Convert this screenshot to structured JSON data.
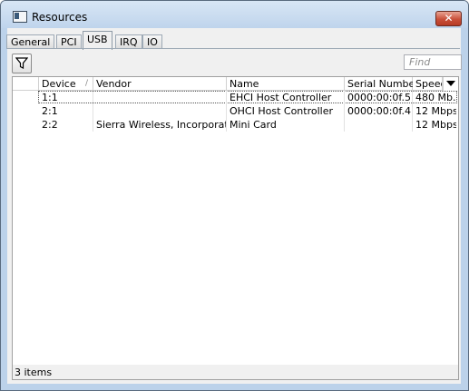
{
  "window": {
    "title": "Resources",
    "close_glyph": "✕"
  },
  "tabs": [
    {
      "label": "General"
    },
    {
      "label": "PCI"
    },
    {
      "label": "USB"
    },
    {
      "label": "IRQ"
    },
    {
      "label": "IO"
    }
  ],
  "toolbar": {
    "filter_icon": "filter-icon",
    "find_placeholder": "Find"
  },
  "table": {
    "columns": [
      "Device",
      "Vendor",
      "Name",
      "Serial Number",
      "Speed"
    ],
    "sort_indicator": "/",
    "rows": [
      {
        "device": "1:1",
        "vendor": "",
        "name": "EHCI Host Controller",
        "serial": "0000:00:0f.5",
        "speed": "480 Mb..."
      },
      {
        "device": "2:1",
        "vendor": "",
        "name": "OHCI Host Controller",
        "serial": "0000:00:0f.4",
        "speed": "12 Mbps"
      },
      {
        "device": "2:2",
        "vendor": "Sierra Wireless, Incorporated",
        "name": "Mini Card",
        "serial": "",
        "speed": "12 Mbps"
      }
    ]
  },
  "status": {
    "text": "3 items"
  }
}
